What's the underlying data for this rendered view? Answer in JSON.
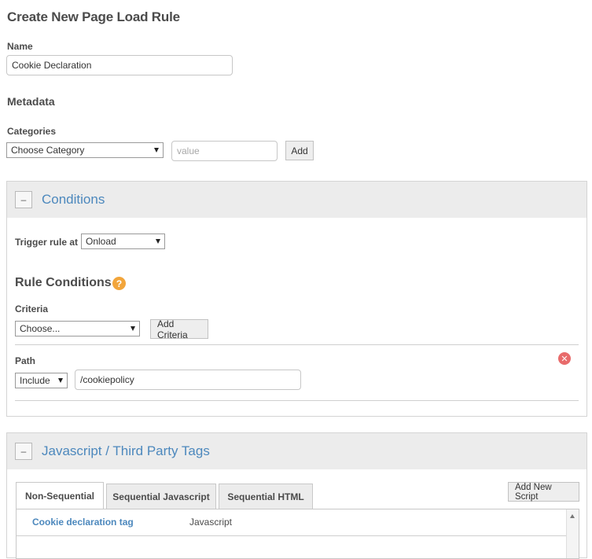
{
  "page": {
    "title": "Create New Page Load Rule"
  },
  "name_field": {
    "label": "Name",
    "value": "Cookie Declaration"
  },
  "metadata": {
    "heading": "Metadata",
    "categories_label": "Categories",
    "category_select": "Choose Category",
    "value_placeholder": "value",
    "add_label": "Add"
  },
  "conditions": {
    "title": "Conditions",
    "collapse_symbol": "–",
    "trigger_label": "Trigger rule at",
    "trigger_value": "Onload",
    "rule_conditions_heading": "Rule Conditions",
    "help_symbol": "?",
    "criteria_label": "Criteria",
    "criteria_select": "Choose...",
    "add_criteria_label": "Add Criteria",
    "path": {
      "label": "Path",
      "mode": "Include",
      "value": "/cookiepolicy",
      "remove_symbol": "✕"
    }
  },
  "tags": {
    "title": "Javascript / Third Party Tags",
    "collapse_symbol": "–",
    "tabs": [
      {
        "label": "Non-Sequential",
        "active": true
      },
      {
        "label": "Sequential Javascript",
        "active": false
      },
      {
        "label": "Sequential HTML",
        "active": false
      }
    ],
    "add_script_label": "Add New Script",
    "rows": [
      {
        "name": "Cookie declaration tag",
        "type": "Javascript"
      }
    ]
  },
  "colors": {
    "link_blue": "#4c88bd",
    "header_gray": "#ececec",
    "help_orange": "#f2a53b",
    "remove_red": "#e86b6b"
  }
}
